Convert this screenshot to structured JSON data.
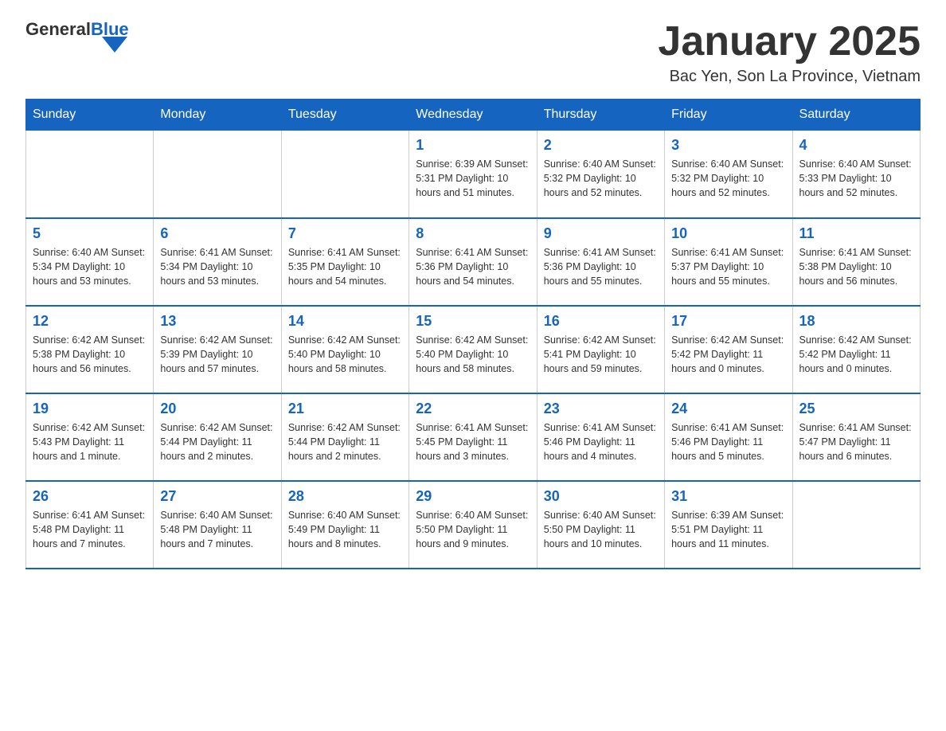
{
  "logo": {
    "text_general": "General",
    "text_blue": "Blue"
  },
  "header": {
    "month_title": "January 2025",
    "location": "Bac Yen, Son La Province, Vietnam"
  },
  "days_of_week": [
    "Sunday",
    "Monday",
    "Tuesday",
    "Wednesday",
    "Thursday",
    "Friday",
    "Saturday"
  ],
  "weeks": [
    [
      {
        "day": "",
        "info": ""
      },
      {
        "day": "",
        "info": ""
      },
      {
        "day": "",
        "info": ""
      },
      {
        "day": "1",
        "info": "Sunrise: 6:39 AM\nSunset: 5:31 PM\nDaylight: 10 hours and 51 minutes."
      },
      {
        "day": "2",
        "info": "Sunrise: 6:40 AM\nSunset: 5:32 PM\nDaylight: 10 hours and 52 minutes."
      },
      {
        "day": "3",
        "info": "Sunrise: 6:40 AM\nSunset: 5:32 PM\nDaylight: 10 hours and 52 minutes."
      },
      {
        "day": "4",
        "info": "Sunrise: 6:40 AM\nSunset: 5:33 PM\nDaylight: 10 hours and 52 minutes."
      }
    ],
    [
      {
        "day": "5",
        "info": "Sunrise: 6:40 AM\nSunset: 5:34 PM\nDaylight: 10 hours and 53 minutes."
      },
      {
        "day": "6",
        "info": "Sunrise: 6:41 AM\nSunset: 5:34 PM\nDaylight: 10 hours and 53 minutes."
      },
      {
        "day": "7",
        "info": "Sunrise: 6:41 AM\nSunset: 5:35 PM\nDaylight: 10 hours and 54 minutes."
      },
      {
        "day": "8",
        "info": "Sunrise: 6:41 AM\nSunset: 5:36 PM\nDaylight: 10 hours and 54 minutes."
      },
      {
        "day": "9",
        "info": "Sunrise: 6:41 AM\nSunset: 5:36 PM\nDaylight: 10 hours and 55 minutes."
      },
      {
        "day": "10",
        "info": "Sunrise: 6:41 AM\nSunset: 5:37 PM\nDaylight: 10 hours and 55 minutes."
      },
      {
        "day": "11",
        "info": "Sunrise: 6:41 AM\nSunset: 5:38 PM\nDaylight: 10 hours and 56 minutes."
      }
    ],
    [
      {
        "day": "12",
        "info": "Sunrise: 6:42 AM\nSunset: 5:38 PM\nDaylight: 10 hours and 56 minutes."
      },
      {
        "day": "13",
        "info": "Sunrise: 6:42 AM\nSunset: 5:39 PM\nDaylight: 10 hours and 57 minutes."
      },
      {
        "day": "14",
        "info": "Sunrise: 6:42 AM\nSunset: 5:40 PM\nDaylight: 10 hours and 58 minutes."
      },
      {
        "day": "15",
        "info": "Sunrise: 6:42 AM\nSunset: 5:40 PM\nDaylight: 10 hours and 58 minutes."
      },
      {
        "day": "16",
        "info": "Sunrise: 6:42 AM\nSunset: 5:41 PM\nDaylight: 10 hours and 59 minutes."
      },
      {
        "day": "17",
        "info": "Sunrise: 6:42 AM\nSunset: 5:42 PM\nDaylight: 11 hours and 0 minutes."
      },
      {
        "day": "18",
        "info": "Sunrise: 6:42 AM\nSunset: 5:42 PM\nDaylight: 11 hours and 0 minutes."
      }
    ],
    [
      {
        "day": "19",
        "info": "Sunrise: 6:42 AM\nSunset: 5:43 PM\nDaylight: 11 hours and 1 minute."
      },
      {
        "day": "20",
        "info": "Sunrise: 6:42 AM\nSunset: 5:44 PM\nDaylight: 11 hours and 2 minutes."
      },
      {
        "day": "21",
        "info": "Sunrise: 6:42 AM\nSunset: 5:44 PM\nDaylight: 11 hours and 2 minutes."
      },
      {
        "day": "22",
        "info": "Sunrise: 6:41 AM\nSunset: 5:45 PM\nDaylight: 11 hours and 3 minutes."
      },
      {
        "day": "23",
        "info": "Sunrise: 6:41 AM\nSunset: 5:46 PM\nDaylight: 11 hours and 4 minutes."
      },
      {
        "day": "24",
        "info": "Sunrise: 6:41 AM\nSunset: 5:46 PM\nDaylight: 11 hours and 5 minutes."
      },
      {
        "day": "25",
        "info": "Sunrise: 6:41 AM\nSunset: 5:47 PM\nDaylight: 11 hours and 6 minutes."
      }
    ],
    [
      {
        "day": "26",
        "info": "Sunrise: 6:41 AM\nSunset: 5:48 PM\nDaylight: 11 hours and 7 minutes."
      },
      {
        "day": "27",
        "info": "Sunrise: 6:40 AM\nSunset: 5:48 PM\nDaylight: 11 hours and 7 minutes."
      },
      {
        "day": "28",
        "info": "Sunrise: 6:40 AM\nSunset: 5:49 PM\nDaylight: 11 hours and 8 minutes."
      },
      {
        "day": "29",
        "info": "Sunrise: 6:40 AM\nSunset: 5:50 PM\nDaylight: 11 hours and 9 minutes."
      },
      {
        "day": "30",
        "info": "Sunrise: 6:40 AM\nSunset: 5:50 PM\nDaylight: 11 hours and 10 minutes."
      },
      {
        "day": "31",
        "info": "Sunrise: 6:39 AM\nSunset: 5:51 PM\nDaylight: 11 hours and 11 minutes."
      },
      {
        "day": "",
        "info": ""
      }
    ]
  ]
}
